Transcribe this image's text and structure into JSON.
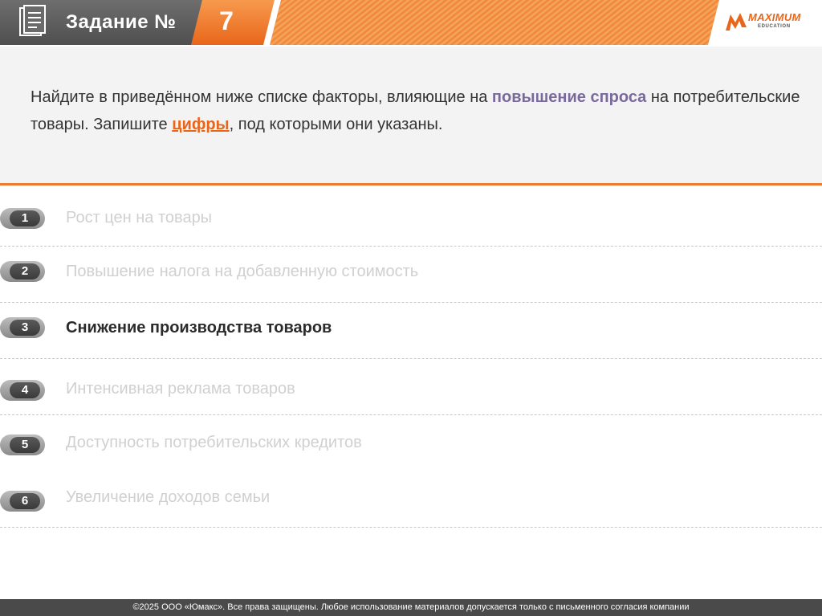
{
  "header": {
    "title": "Задание №",
    "number": "7",
    "logo": {
      "brand": "MAXIMUM",
      "sub": "EDUCATION"
    },
    "accent": "#e8661b"
  },
  "question": {
    "part1": "Найдите в приведённом ниже списке факторы, влияющие на ",
    "highlight1": "повышение спроса",
    "part2": " на потребительские товары. Запишите ",
    "highlight2": "цифры",
    "part3": ", под которыми они указаны."
  },
  "items": [
    {
      "num": "1",
      "label": "Рост цен на товары",
      "selected": false
    },
    {
      "num": "2",
      "label": "Повышение налога на добавленную стоимость",
      "selected": false
    },
    {
      "num": "3",
      "label": "Снижение производства товаров",
      "selected": true
    },
    {
      "num": "4",
      "label": "Интенсивная реклама товаров",
      "selected": false
    },
    {
      "num": "5",
      "label": "Доступность потребительских кредитов",
      "selected": false
    },
    {
      "num": "6",
      "label": "Увеличение доходов семьи",
      "selected": false
    }
  ],
  "footer": {
    "text": "©2025 ООО «Юмакс». Все права защищены. Любое использование материалов допускается только с  письменного согласия компании"
  }
}
